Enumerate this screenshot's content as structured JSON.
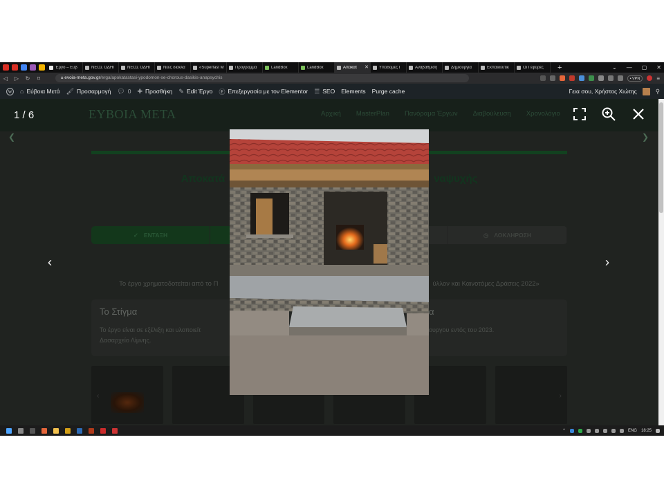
{
  "browser": {
    "tabs": [
      {
        "label": "Έργο – Εύβ",
        "color": "#e8e8e8",
        "active": false
      },
      {
        "label": "ΝΕΟΣ ΟΔΗΓ",
        "color": "#bbbbbb",
        "active": false
      },
      {
        "label": "ΝΕΟΣ ΟΔΗΓ",
        "color": "#bbbbbb",
        "active": false
      },
      {
        "label": "Νέες διακλα",
        "color": "#bbbbbb",
        "active": false
      },
      {
        "label": "«Superfast M",
        "color": "#bbbbbb",
        "active": false
      },
      {
        "label": "Πρόγραμμα",
        "color": "#bbbbbb",
        "active": false
      },
      {
        "label": "LandBox",
        "color": "#7cc05a",
        "active": false
      },
      {
        "label": "LandBox",
        "color": "#7cc05a",
        "active": false
      },
      {
        "label": "Αποκατ",
        "color": "#bbbbbb",
        "active": true
      },
      {
        "label": "Υποδομές Γ",
        "color": "#bbbbbb",
        "active": false
      },
      {
        "label": "Αναβάθμιση",
        "color": "#bbbbbb",
        "active": false
      },
      {
        "label": "Δημιουργία",
        "color": "#bbbbbb",
        "active": false
      },
      {
        "label": "Εκπαιδευτικ",
        "color": "#bbbbbb",
        "active": false
      },
      {
        "label": "Οι Γέφυρες",
        "color": "#bbbbbb",
        "active": false
      }
    ],
    "pinned_icon_colors": [
      "#d93025",
      "#d93025",
      "#4285f4",
      "#9b59b6",
      "#f4b400"
    ],
    "new_tab": "+",
    "url_host": "evoia-meta.gov.gr",
    "url_path": "/erga/apokatastasi-ypodomon-se-chorous-dasikis-anapsychis",
    "vpn_label": "• VPN"
  },
  "wpbar": {
    "site_name": "Εύβοια Μετά",
    "customize": "Προσαρμογή",
    "comments_count": "0",
    "add_new": "Προσθήκη",
    "edit": "Edit Έργο",
    "elementor": "Επεξεργασία με τον Elementor",
    "seo": "SEO",
    "elements": "Elements",
    "purge": "Purge cache",
    "greeting": "Γεια σου, Χρήστος Χιώτης"
  },
  "site": {
    "logo": "ΕΥΒΟΙΑ ΜΕΤΑ",
    "nav": [
      "Αρχική",
      "MasterPlan",
      "Πανόραμα Έργων",
      "Διαβούλευση",
      "Χρονολόγιο"
    ],
    "title_left": "Αποκατά",
    "title_right": "ναψυχής",
    "steps": [
      {
        "label": "ΕΝΤΑΞΗ",
        "done": true
      },
      {
        "label": "",
        "done": true
      },
      {
        "label": "",
        "done": false
      },
      {
        "label": "ΛΟΚΛΗΡΩΣΗ",
        "done": false
      }
    ],
    "funding_left": "Το έργο χρηματοδοτείται από το Π",
    "funding_right": "ύλλον και Καινοτόμες Δράσεις 2022»",
    "card_left": {
      "title": "Το Στίγμα",
      "text": "Το έργο είναι σε εξέλιξη και υλοποιείτ",
      "text2": "Δασαρχείο Λίμνης."
    },
    "card_right": {
      "title": "α",
      "text": "ουργου εντός του 2023."
    }
  },
  "lightbox": {
    "counter": "1 / 6",
    "prev": "‹",
    "next": "›"
  },
  "taskbar": {
    "lang": "ENG",
    "time": "18:25"
  }
}
